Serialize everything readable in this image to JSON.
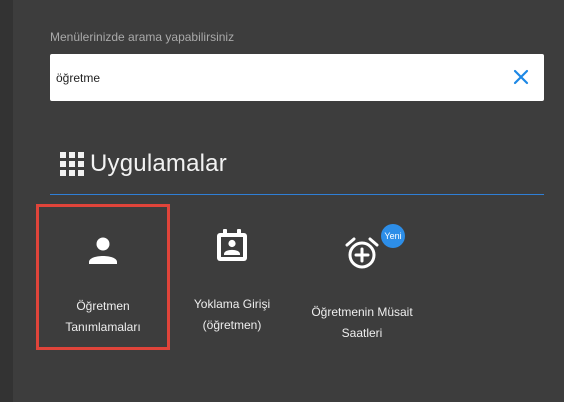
{
  "search": {
    "label": "Menülerinizde arama yapabilirsiniz",
    "value": "öğretme",
    "clear_icon": "close-icon"
  },
  "section": {
    "icon": "apps-grid-icon",
    "title": "Uygulamalar"
  },
  "apps": [
    {
      "line1": "Öğretmen",
      "line2": "Tanımlamaları",
      "icon": "person-icon",
      "selected": true
    },
    {
      "line1": "Yoklama Girişi",
      "line2": "(öğretmen)",
      "icon": "calendar-person-icon",
      "selected": false
    },
    {
      "line1": "Öğretmenin Müsait",
      "line2": "Saatleri",
      "icon": "alarm-add-icon",
      "badge": "Yeni",
      "selected": false
    }
  ],
  "colors": {
    "accent": "#2d8ee8",
    "selection": "#e0443a",
    "background": "#3d3d3d"
  }
}
